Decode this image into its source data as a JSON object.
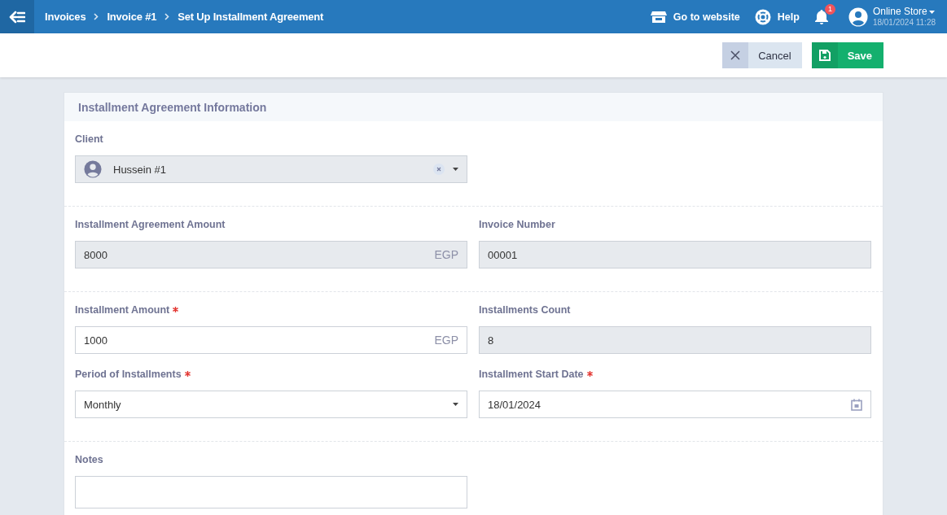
{
  "topbar": {
    "breadcrumbs": [
      "Invoices",
      "Invoice #1",
      "Set Up Installment Agreement"
    ],
    "links": [
      {
        "kind": "website",
        "label": "Go to website"
      },
      {
        "kind": "help",
        "label": "Help"
      }
    ],
    "notifications": {
      "count": "1"
    },
    "account": {
      "name": "Online Store",
      "datetime": "18/01/2024 11:28"
    }
  },
  "actions": [
    {
      "kind": "cancel",
      "label": "Cancel"
    },
    {
      "kind": "save",
      "label": "Save"
    }
  ],
  "card": {
    "title": "Installment Agreement Information",
    "sections": [
      {
        "fields": [
          {
            "kind": "client",
            "label": "Client",
            "value": "Hussein #1",
            "required": false,
            "disabled": true
          }
        ]
      },
      {
        "fields": [
          {
            "kind": "amount",
            "label": "Installment Agreement Amount",
            "value": "8000",
            "suffix": "EGP",
            "required": false,
            "disabled": true
          },
          {
            "kind": "text",
            "label": "Invoice Number",
            "value": "00001",
            "required": false,
            "disabled": true
          }
        ]
      },
      {
        "fields": [
          {
            "kind": "amount",
            "label": "Installment Amount",
            "value": "1000",
            "suffix": "EGP",
            "required": true,
            "disabled": false
          },
          {
            "kind": "text",
            "label": "Installments Count",
            "value": "8",
            "required": false,
            "disabled": true
          },
          {
            "kind": "select",
            "label": "Period of Installments",
            "value": "Monthly",
            "required": true,
            "disabled": false
          },
          {
            "kind": "date",
            "label": "Installment Start Date",
            "value": "18/01/2024",
            "required": true,
            "disabled": false
          }
        ]
      },
      {
        "fields": [
          {
            "kind": "textarea",
            "label": "Notes",
            "required": false,
            "disabled": false
          }
        ]
      }
    ]
  }
}
